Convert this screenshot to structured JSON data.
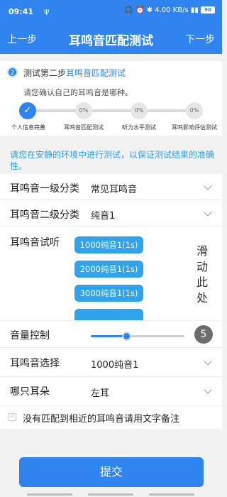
{
  "status_bar": {
    "time": "09:41",
    "volume_icon": "vibrate-icon",
    "right_text": "🎧 ⏰ ✱ 4.00 KB/s ▮▮ ",
    "battery": "90"
  },
  "navbar": {
    "prev": "上一步",
    "title": "耳鸣音匹配测试",
    "next": "下一步"
  },
  "step": {
    "number": "2",
    "title_prefix": "测试第二步",
    "title_highlight": "耳鸣音匹配测试",
    "desc": "请您确认自己的耳鸣音是哪种。"
  },
  "progress": {
    "nodes": [
      {
        "label": "个人信息完善",
        "value": "✓",
        "done": true
      },
      {
        "label": "耳鸣音匹配测试",
        "value": "0%",
        "done": false
      },
      {
        "label": "听力水平测试",
        "value": "0%",
        "done": false
      },
      {
        "label": "耳鸣影响评估测试",
        "value": "0%",
        "done": false
      }
    ]
  },
  "notice": "请您在安静的环境中进行测试，以保证测试结果的准确性。",
  "rows": {
    "level1": {
      "label": "耳鸣音一级分类",
      "value": "常见耳鸣音"
    },
    "level2": {
      "label": "耳鸣音二级分类",
      "value": "纯音1"
    },
    "select": {
      "label": "耳鸣音选择",
      "value": "1000纯音1"
    },
    "ear": {
      "label": "哪只耳朵",
      "value": "左耳"
    }
  },
  "tones": {
    "label": "耳鸣音试听",
    "items": [
      "1000纯音1(1s)",
      "2000纯音1(1s)",
      "3000纯音1(1s)",
      ""
    ],
    "scroll_hint": [
      "滑",
      "动",
      "此",
      "处"
    ]
  },
  "volume": {
    "label": "音量控制",
    "value": "5",
    "level_fraction": 0.38
  },
  "checkbox": {
    "label": "没有匹配到相近的耳鸣音请用文字备注",
    "checked": false
  },
  "submit": "提交",
  "colors": {
    "primary": "#2f84f0",
    "tone_button": "#2fa3ee",
    "notice": "#2fa0e6"
  }
}
